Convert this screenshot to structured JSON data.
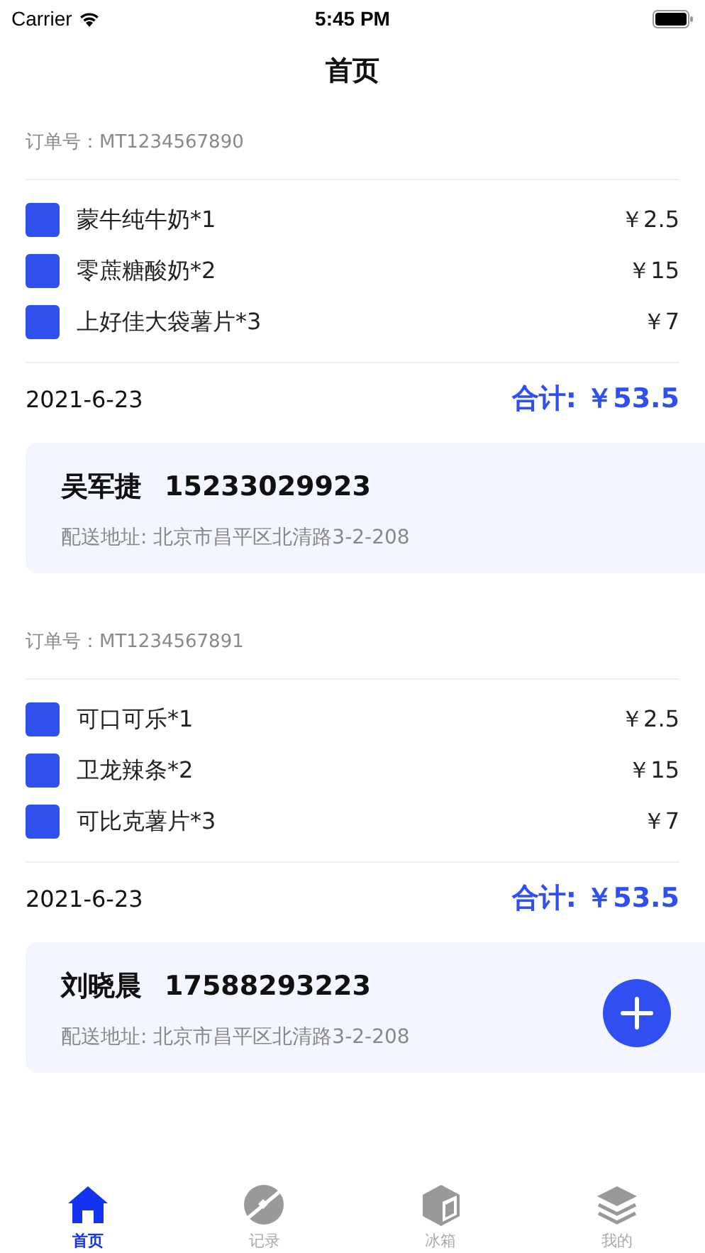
{
  "status_bar": {
    "carrier": "Carrier",
    "time": "5:45 PM"
  },
  "nav": {
    "title": "首页"
  },
  "orders": [
    {
      "order_no": "订单号：MT1234567890",
      "items": [
        {
          "name": "蒙牛纯牛奶*1",
          "price": "￥2.5"
        },
        {
          "name": "零蔗糖酸奶*2",
          "price": "￥15"
        },
        {
          "name": "上好佳大袋薯片*3",
          "price": "￥7"
        }
      ],
      "date": "2021-6-23",
      "total": "合计: ￥53.5",
      "customer": {
        "name": "吴军捷",
        "phone": "15233029923",
        "address": "配送地址: 北京市昌平区北清路3-2-208"
      }
    },
    {
      "order_no": "订单号：MT1234567891",
      "items": [
        {
          "name": "可口可乐*1",
          "price": "￥2.5"
        },
        {
          "name": "卫龙辣条*2",
          "price": "￥15"
        },
        {
          "name": "可比克薯片*3",
          "price": "￥7"
        }
      ],
      "date": "2021-6-23",
      "total": "合计: ￥53.5",
      "customer": {
        "name": "刘晓晨",
        "phone": "17588293223",
        "address": "配送地址: 北京市昌平区北清路3-2-208"
      }
    }
  ],
  "add_button": {
    "kind": "plus"
  },
  "tabs": [
    {
      "label": "首页",
      "kind": "home",
      "selected": true
    },
    {
      "label": "记录",
      "kind": "planet",
      "selected": false
    },
    {
      "label": "冰箱",
      "kind": "box",
      "selected": false
    },
    {
      "label": "我的",
      "kind": "layers",
      "selected": false
    }
  ]
}
